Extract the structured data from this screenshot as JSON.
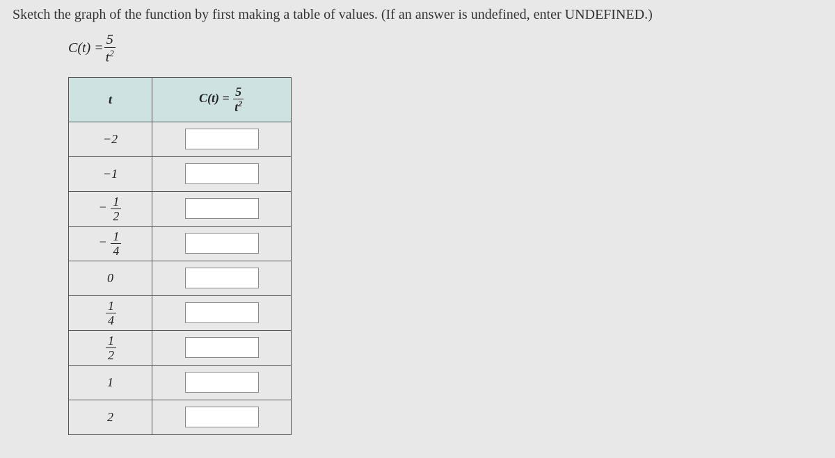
{
  "question": "Sketch the graph of the function by first making a table of values. (If an answer is undefined, enter UNDEFINED.)",
  "equation": {
    "lhs": "C(t) = ",
    "num": "5",
    "den_var": "t",
    "den_exp": "2"
  },
  "table": {
    "header_t": "t",
    "header_c_lhs": "C(t) = ",
    "header_c_num": "5",
    "header_c_den_var": "t",
    "header_c_den_exp": "2",
    "rows": [
      {
        "t_display": "−2",
        "input": ""
      },
      {
        "t_display": "−1",
        "input": ""
      },
      {
        "t_display_frac": {
          "sign": "−",
          "num": "1",
          "den": "2"
        },
        "input": ""
      },
      {
        "t_display_frac": {
          "sign": "−",
          "num": "1",
          "den": "4"
        },
        "input": ""
      },
      {
        "t_display": "0",
        "input": ""
      },
      {
        "t_display_frac": {
          "sign": "",
          "num": "1",
          "den": "4"
        },
        "input": ""
      },
      {
        "t_display_frac": {
          "sign": "",
          "num": "1",
          "den": "2"
        },
        "input": ""
      },
      {
        "t_display": "1",
        "input": ""
      },
      {
        "t_display": "2",
        "input": ""
      }
    ]
  }
}
